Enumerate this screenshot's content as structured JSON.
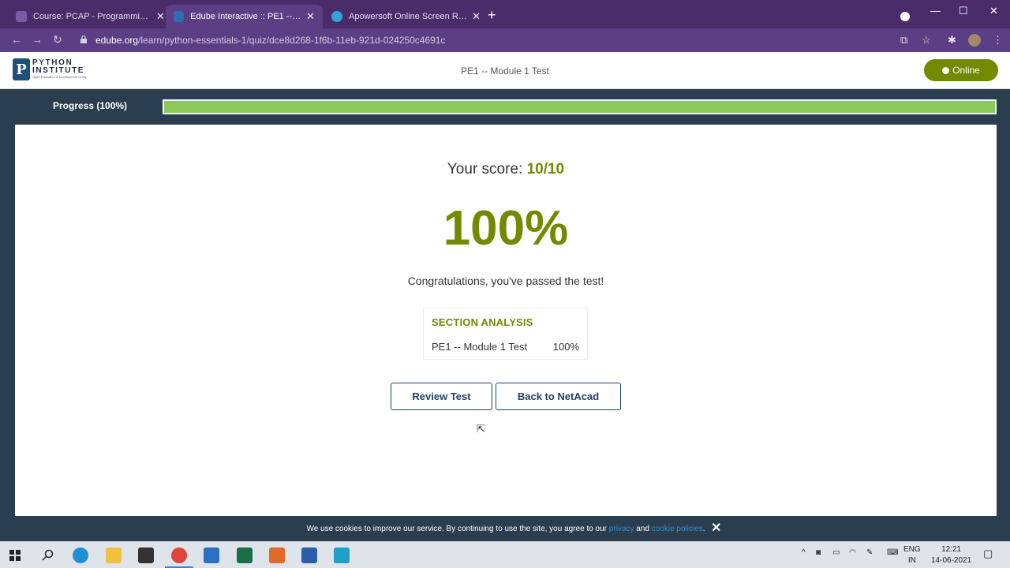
{
  "browser": {
    "tabs": [
      {
        "title": "Course: PCAP - Programming Essentials",
        "active": false
      },
      {
        "title": "Edube Interactive :: PE1 -- Module 1 Test",
        "active": true
      },
      {
        "title": "Apowersoft Online Screen Recorder",
        "active": false
      }
    ],
    "new_tab": "+",
    "url_host": "edube.org",
    "url_path": "/learn/python-essentials-1/quiz/dce8d268-1f6b-11eb-921d-024250c4691c"
  },
  "header": {
    "logo_line1": "PYTHON",
    "logo_line2": "INSTITUTE",
    "logo_line3": "Open Education & Development Group",
    "logo_mark": "P",
    "title": "PE1 -- Module 1 Test",
    "online_label": "Online"
  },
  "progress": {
    "label": "Progress (100%)",
    "value": 1.0
  },
  "result": {
    "score_label": "Your score: ",
    "score_value": "10/10",
    "percent": "100%",
    "message": "Congratulations, you've passed the test!"
  },
  "analysis": {
    "heading": "SECTION ANALYSIS",
    "rows": [
      {
        "name": "PE1 -- Module 1 Test",
        "value": "100%"
      }
    ]
  },
  "buttons": {
    "review": "Review Test",
    "back": "Back to NetAcad"
  },
  "cookie": {
    "text_before": "We use cookies to improve our service. By continuing to use the site, you agree to our ",
    "privacy": "privacy",
    "and": " and ",
    "policies": "cookie policies",
    "dot": ".",
    "close": "✕"
  },
  "taskbar": {
    "lang1": "ENG",
    "lang2": "IN",
    "time": "12:21",
    "date": "14-06-2021"
  },
  "colors": {
    "accent": "#718a00",
    "progress": "#8cc85a",
    "page_bg": "#2b3e4f",
    "tabbar": "#4a2c6b"
  }
}
